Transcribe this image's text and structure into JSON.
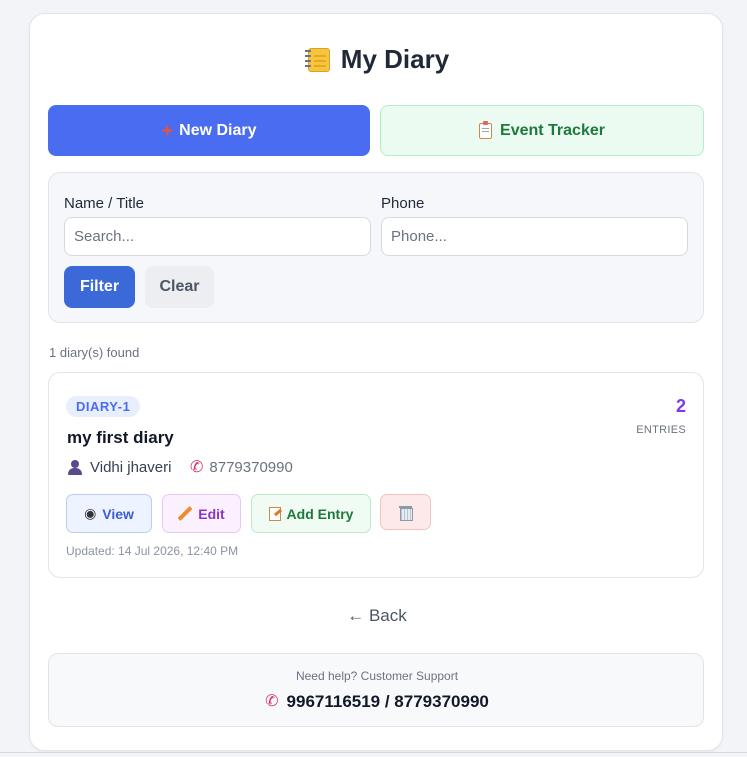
{
  "header": {
    "title": "My Diary",
    "icon": "notebook-icon"
  },
  "actions": {
    "new_diary_label": "New Diary",
    "event_tracker_label": "Event Tracker"
  },
  "filter": {
    "name_label": "Name / Title",
    "name_placeholder": "Search...",
    "phone_label": "Phone",
    "phone_placeholder": "Phone...",
    "filter_button": "Filter",
    "clear_button": "Clear"
  },
  "results": {
    "found_text": "1 diary(s) found"
  },
  "diaries": [
    {
      "badge": "DIARY-1",
      "title": "my first diary",
      "owner": "Vidhi jhaveri",
      "phone": "8779370990",
      "entries_count": "2",
      "entries_label": "ENTRIES",
      "view_label": "View",
      "edit_label": "Edit",
      "add_entry_label": "Add Entry",
      "updated": "Updated: 14 Jul 2026, 12:40 PM"
    }
  ],
  "back_label": "← Back",
  "support": {
    "text": "Need help? Customer Support",
    "phones": "9967116519 / 8779370990"
  },
  "colors": {
    "primary": "#4a6cf0",
    "filter_button": "#3b6ad8",
    "entries_accent": "#7c3aed",
    "event_tracker_text": "#1e7a3c"
  }
}
